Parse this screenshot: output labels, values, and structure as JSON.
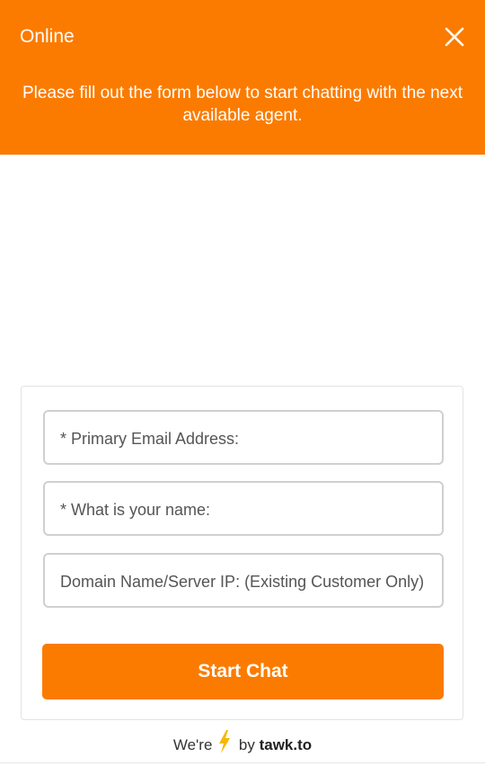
{
  "header": {
    "status": "Online",
    "close_icon": "close-icon",
    "intro": "Please fill out the form below to start chatting with the next available agent.",
    "background_color": "#fb7b00"
  },
  "form": {
    "email_placeholder": "* Primary Email Address:",
    "name_placeholder": "* What is your name:",
    "domain_placeholder": "Domain Name/Server IP: (Existing Customer Only)",
    "submit_label": "Start Chat"
  },
  "footer": {
    "prefix": "We're",
    "bolt_icon": "lightning-bolt-icon",
    "by": "by",
    "brand": "tawk.to"
  }
}
